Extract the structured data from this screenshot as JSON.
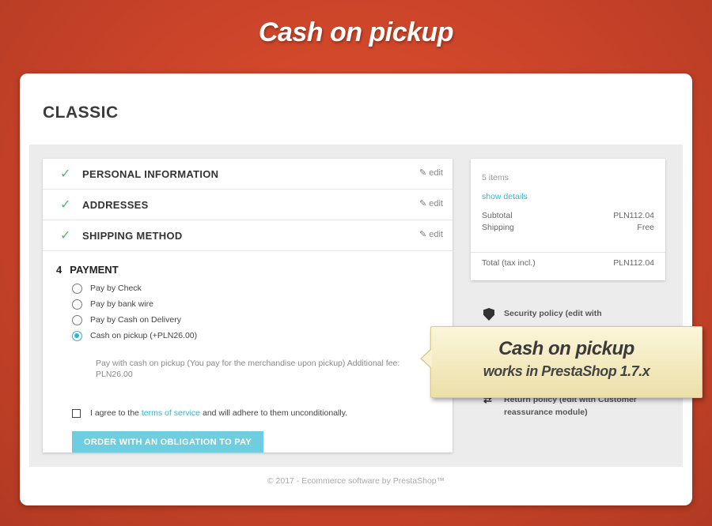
{
  "banner": {
    "title": "Cash on pickup"
  },
  "shop": {
    "name": "CLASSIC"
  },
  "steps": [
    {
      "title": "PERSONAL INFORMATION",
      "edit": "edit"
    },
    {
      "title": "ADDRESSES",
      "edit": "edit"
    },
    {
      "title": "SHIPPING METHOD",
      "edit": "edit"
    }
  ],
  "payment": {
    "number": "4",
    "title": "PAYMENT",
    "options": [
      {
        "label": "Pay by Check",
        "selected": false
      },
      {
        "label": "Pay by bank wire",
        "selected": false
      },
      {
        "label": "Pay by Cash on Delivery",
        "selected": false
      },
      {
        "label": "Cash on pickup (+PLN26.00)",
        "selected": true
      }
    ],
    "description": "Pay with cash on pickup (You pay for the merchandise upon pickup) Additional fee: PLN26.00",
    "terms_before": "I agree to the",
    "terms_link": "terms of service",
    "terms_after": "and will adhere to them unconditionally.",
    "order_button": "ORDER WITH AN OBLIGATION TO PAY"
  },
  "summary": {
    "items": "5 items",
    "show_details": "show details",
    "subtotal_label": "Subtotal",
    "subtotal_value": "PLN112.04",
    "shipping_label": "Shipping",
    "shipping_value": "Free",
    "total_label": "Total (tax incl.)",
    "total_value": "PLN112.04"
  },
  "reassurance": {
    "security": "Security policy (edit with",
    "return": "Return policy (edit with Customer reassurance module)"
  },
  "footer": {
    "text": "© 2017 - Ecommerce software by PrestaShop™"
  },
  "callout": {
    "title": "Cash on pickup",
    "subtitle": "works in PrestaShop 1.7.x"
  },
  "colors": {
    "accent": "#2fb5d2",
    "check": "#4cbb6c",
    "button": "#6fcde0",
    "banner": "#c9432a"
  },
  "icons": [
    "check-icon",
    "pencil-icon",
    "shield-icon",
    "arrows-icon"
  ]
}
